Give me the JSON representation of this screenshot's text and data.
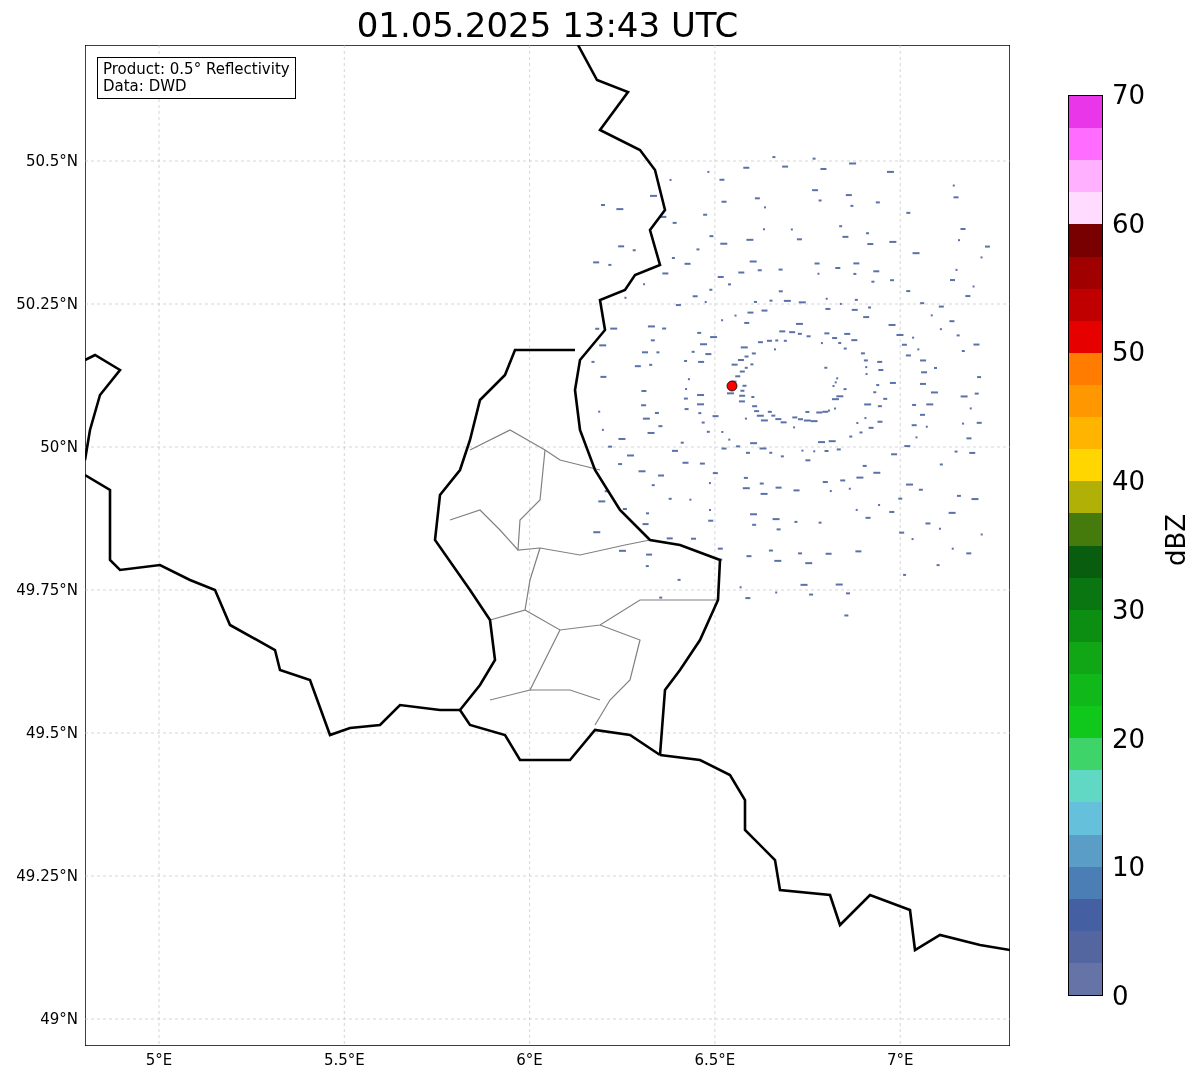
{
  "title": "01.05.2025 13:43 UTC",
  "info_box": [
    "Product: 0.5° Reflectivity",
    "Data: DWD"
  ],
  "map": {
    "y_ticks": [
      "50.5°N",
      "50.25°N",
      "50°N",
      "49.75°N",
      "49.5°N",
      "49.25°N",
      "49°N"
    ],
    "x_ticks": [
      "5°E",
      "5.5°E",
      "6°E",
      "6.5°E",
      "7°E"
    ]
  },
  "colorbar": {
    "label": "dBZ",
    "ticks": [
      "70",
      "60",
      "50",
      "40",
      "30",
      "20",
      "10",
      "0"
    ],
    "bins": [
      {
        "color": "#6673a6"
      },
      {
        "color": "#5366a0"
      },
      {
        "color": "#4460a2"
      },
      {
        "color": "#4a7eb4"
      },
      {
        "color": "#5a9ec8"
      },
      {
        "color": "#65c0dc"
      },
      {
        "color": "#60d8c4"
      },
      {
        "color": "#3ed46a"
      },
      {
        "color": "#10c81c"
      },
      {
        "color": "#10b81a"
      },
      {
        "color": "#10a615"
      },
      {
        "color": "#0b8e12"
      },
      {
        "color": "#0a7612"
      },
      {
        "color": "#085e0e"
      },
      {
        "color": "#457a0c"
      },
      {
        "color": "#b0b006"
      },
      {
        "color": "#ffd600"
      },
      {
        "color": "#ffb400"
      },
      {
        "color": "#ff9800"
      },
      {
        "color": "#ff7c00"
      },
      {
        "color": "#e60000"
      },
      {
        "color": "#c00000"
      },
      {
        "color": "#a00000"
      },
      {
        "color": "#780000"
      },
      {
        "color": "#ffdcff"
      },
      {
        "color": "#ffb0ff"
      },
      {
        "color": "#ff6cff"
      },
      {
        "color": "#e836e8"
      }
    ]
  }
}
